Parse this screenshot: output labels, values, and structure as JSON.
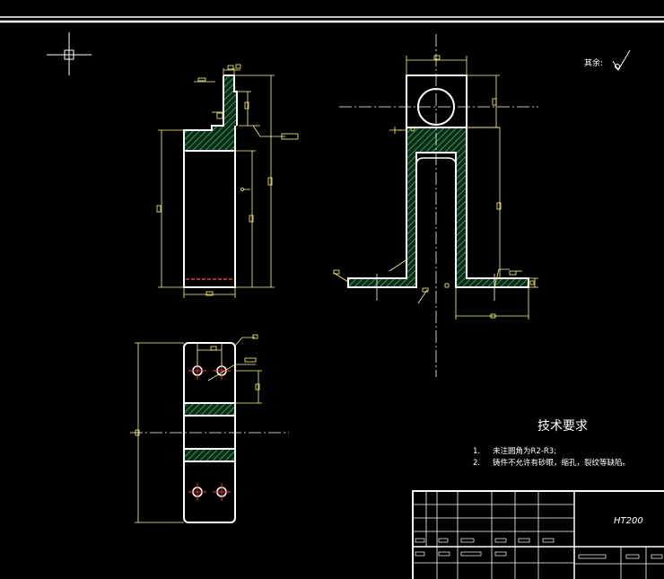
{
  "drawing": {
    "roughness_label": "其余:",
    "tech_title": "技术要求",
    "requirements": [
      {
        "num": "1.",
        "text": "未注圆角为R2-R3;"
      },
      {
        "num": "2.",
        "text": "铸件不允许有砂眼，缩孔，裂纹等缺陷。"
      }
    ],
    "material": "HT200",
    "colors": {
      "background": "#000000",
      "outline": "#ffffff",
      "dimension": "#ffff66",
      "hatch": "#2e8b57",
      "hole_center": "#ff3030"
    }
  }
}
